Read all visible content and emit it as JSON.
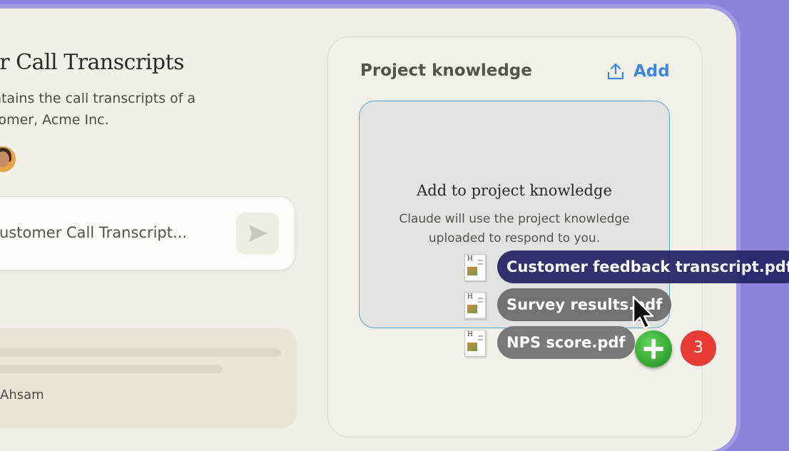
{
  "project": {
    "title": "er Call Transcripts",
    "description_line1": "ntains the call transcripts of a",
    "description_line2": "tomer, Acme Inc."
  },
  "chat": {
    "input_text": "ustomer Call Transcript...",
    "preview_author": "Ahsam"
  },
  "knowledge": {
    "title": "Project knowledge",
    "add_label": "Add",
    "drop_title": "Add to project knowledge",
    "drop_desc_line1": "Claude will use the project knowledge",
    "drop_desc_line2": "uploaded to respond to you."
  },
  "drag": {
    "files": [
      {
        "name": "Customer feedback transcript.pdf"
      },
      {
        "name": "Survey results.pdf"
      },
      {
        "name": "NPS score.pdf"
      }
    ],
    "count": "3"
  },
  "colors": {
    "background": "#8c84dc",
    "accent": "#3c87d9",
    "add_badge": "#2fae2a",
    "count_badge": "#e83a36"
  },
  "icons": [
    "send-icon",
    "upload-icon",
    "file-pdf-icon",
    "plus-icon",
    "cursor-icon"
  ]
}
